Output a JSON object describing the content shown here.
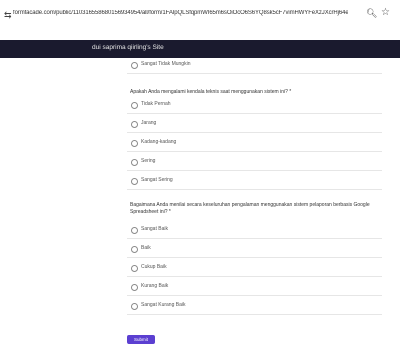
{
  "browser": {
    "url": "formfacade.com/public/110316558680156934954/all/form/1FAIpQLSfqpmWI65m6sOiOcO6S6YQ8sk5cF7vimHWYFeXzJXcrHj64eQ"
  },
  "site": {
    "title": "dui saprima qiirling's Site"
  },
  "form": {
    "top_option": "Sangat Tidak Mungkin",
    "q1": {
      "text": "Apakah Anda mengalami kendala teknis saat menggunakan sistem ini? *",
      "options": [
        "Tidak Pernah",
        "Jarang",
        "Kadang-kadang",
        "Sering",
        "Sangat Sering"
      ]
    },
    "q2": {
      "text": "Bagaimana Anda menilai secara keseluruhan pengalaman menggunakan sistem pelaporan berbasis Google Spreadsheet ini? *",
      "options": [
        "Sangat Baik",
        "Baik",
        "Cukup Baik",
        "Kurang Baik",
        "Sangat Kurang Baik"
      ]
    },
    "submit_label": "Submit"
  }
}
